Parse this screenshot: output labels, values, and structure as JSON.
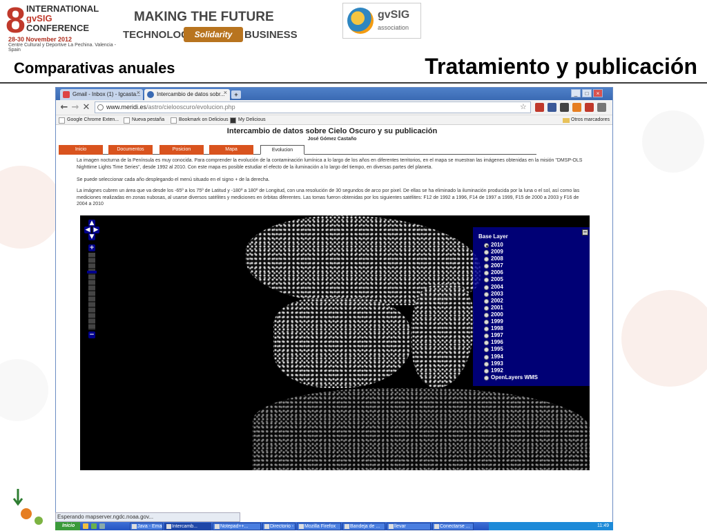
{
  "slide": {
    "conference": {
      "number": "8",
      "line1": "INTERNATIONAL",
      "line2": "gvSIG",
      "line3": "CONFERENCE",
      "dates": "28-30 November 2012",
      "venue": "Centre Cultural y Deportive La Pechina. Valencia - Spain"
    },
    "banner": {
      "making": "MAKING THE FUTURE",
      "technology": "TECHNOLOGY",
      "solidarity": "Solidarity",
      "business": "BUSINESS"
    },
    "gvsig_logo": {
      "name": "gvSIG",
      "sub": "association"
    },
    "subtitle": "Comparativas anuales",
    "title": "Tratamiento y publicación"
  },
  "browser": {
    "tabs": [
      {
        "label": "Gmail - Inbox (1) - lgcasta...",
        "close": "×"
      },
      {
        "label": "Intercambio de datos sobr...",
        "close": "×"
      }
    ],
    "newtab": "+",
    "window_buttons": [
      "_",
      "□",
      "×"
    ],
    "nav": {
      "back": "←",
      "forward": "→",
      "stop": "✕"
    },
    "url_host": "www.meridi.es",
    "url_path": "/astro/cielooscuro/evolucion.php",
    "star": "☆",
    "bookmarks": [
      "Google Chrome Exten...",
      "Nueva pestaña",
      "Bookmark on Delicious",
      "My Delicious"
    ],
    "other_bookmarks": "Otros marcadores"
  },
  "page": {
    "title": "Intercambio de datos sobre Cielo Oscuro y su publicación",
    "author": "José Gómez Castaño",
    "nav_tabs": [
      "Inicio",
      "Documentos",
      "Posicion",
      "Mapa",
      "Evolucion"
    ],
    "active_tab": "Evolucion",
    "paragraphs": [
      "La imagen nocturna de la Península es muy conocida. Para comprender la evolución de la contaminación lumínica a lo largo de los años en diferentes territorios, en el mapa se muestran las imágenes obtenidas en la misión \"DMSP-OLS Nighttime Lights Time Series\", desde 1992 al 2010. Con este mapa es posible estudiar el efecto de la iluminación a lo largo del tiempo, en diversas partes del planeta.",
      "Se puede seleccionar cada año desplegando el menú situado en el signo + de la derecha.",
      "La imágnes cubren un área que va desde los -65º a los 75º de Latitud y -180º a 180º de Longitud, con una resolución de 30 segundos de arco por pixel. De ellas se ha eliminado la iluminación producida por la luna o el sol, así como las mediciones realizadas en zonas nubosas, al usarse diversos satélites y mediciones en órbitas diferentes. Las tomas fueron obtenidas por los siguientes satélites: F12 de 1992 a 1996, F14 de 1997 a 1999, F15 de 2000 a 2003 y F16 de 2004 a 2010"
    ]
  },
  "map": {
    "zoom_in": "+",
    "zoom_out": "−",
    "layer_panel": {
      "title": "Base Layer",
      "minimize": "−",
      "selected": "2010",
      "layers": [
        "2010",
        "2009",
        "2008",
        "2007",
        "2006",
        "2005",
        "2004",
        "2003",
        "2002",
        "2001",
        "2000",
        "1999",
        "1998",
        "1997",
        "1996",
        "1995",
        "1994",
        "1993",
        "1992",
        "OpenLayers WMS"
      ]
    }
  },
  "statusbar": "Esperando mapserver.ngdc.noaa.gov...",
  "taskbar": {
    "start": "Inicio",
    "tasks": [
      "Java - Email...",
      "Intercamb...",
      "Notepad++...",
      "Directorio - ...",
      "Mozilla Firefox",
      "Bandeja de ...",
      "llevar",
      "Conectarse ..."
    ],
    "active_task": "Intercamb...",
    "clock": "11:49"
  },
  "colors": {
    "nav_tab": "#d9531e",
    "layer_panel": "#00008b",
    "title_bar": "#4f80c8"
  }
}
